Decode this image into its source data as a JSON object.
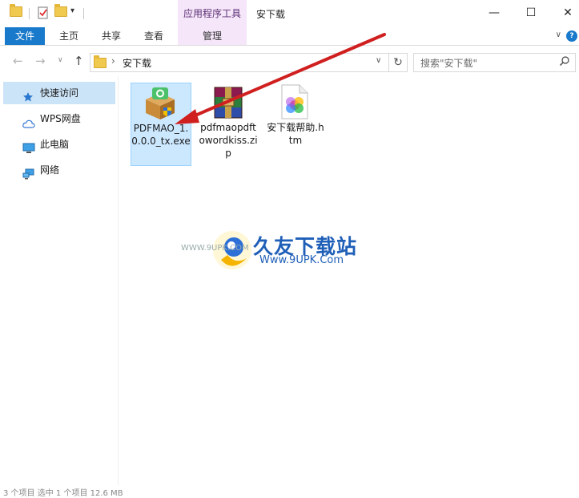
{
  "window": {
    "title": "安下载",
    "tool_tab_title": "应用程序工具",
    "minimize": "—",
    "maximize": "☐",
    "close": "✕"
  },
  "ribbon": {
    "tabs": [
      "文件",
      "主页",
      "共享",
      "查看",
      "管理"
    ],
    "help": "?",
    "collapse": "∨"
  },
  "address": {
    "path": "安下载",
    "separator": "›",
    "refresh": "↻",
    "dropdown": "∨"
  },
  "search": {
    "placeholder": "搜索\"安下载\"",
    "icon": "search-icon"
  },
  "navigation": {
    "back": "←",
    "forward": "→",
    "recent": "∨",
    "up": "↑"
  },
  "sidebar": {
    "items": [
      {
        "label": "快速访问",
        "icon": "star-icon"
      },
      {
        "label": "WPS网盘",
        "icon": "cloud-icon"
      },
      {
        "label": "此电脑",
        "icon": "computer-icon"
      },
      {
        "label": "网络",
        "icon": "network-icon"
      }
    ]
  },
  "files": [
    {
      "name": "PDFMAO_1.0.0.0_tx.exe",
      "icon": "installer-box-icon",
      "selected": true
    },
    {
      "name": "pdfmaopdftowordkiss.zip",
      "icon": "winrar-archive-icon",
      "selected": false
    },
    {
      "name": "安下载帮助.htm",
      "icon": "html-document-icon",
      "selected": false
    }
  ],
  "watermark": {
    "title": "久友下载站",
    "url": "Www.9UPK.Com",
    "left_text": "WWW.9UPK.COM"
  },
  "status": {
    "text": "3 个项目    选中 1 个项目 12.6 MB"
  },
  "colors": {
    "accent": "#1979ca",
    "selection": "#cce8ff",
    "tool_tab": "#f5e6f9",
    "arrow": "#d01f1f"
  }
}
